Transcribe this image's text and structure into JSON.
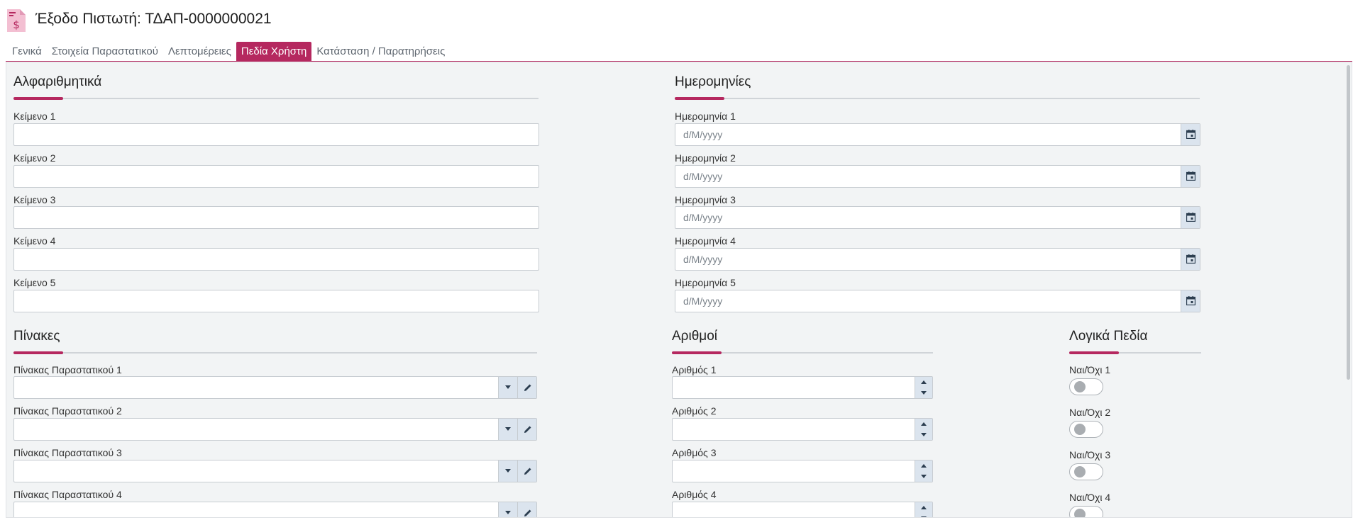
{
  "header": {
    "title": "Έξοδο Πιστωτή: ΤΔΑΠ-0000000021",
    "icon": "dollar-document-icon"
  },
  "tabs": [
    {
      "label": "Γενικά",
      "active": false
    },
    {
      "label": "Στοιχεία Παραστατικού",
      "active": false
    },
    {
      "label": "Λεπτομέρειες",
      "active": false
    },
    {
      "label": "Πεδία Χρήστη",
      "active": true
    },
    {
      "label": "Κατάσταση / Παρατηρήσεις",
      "active": false
    }
  ],
  "colors": {
    "accent": "#b5285f",
    "panel_bg": "#f2f4f5",
    "button_bg": "#dbe4ee"
  },
  "sections": {
    "alphanumeric": {
      "title": "Αλφαριθμητικά",
      "fields": [
        {
          "label": "Κείμενο 1",
          "value": ""
        },
        {
          "label": "Κείμενο 2",
          "value": ""
        },
        {
          "label": "Κείμενο 3",
          "value": ""
        },
        {
          "label": "Κείμενο 4",
          "value": ""
        },
        {
          "label": "Κείμενο 5",
          "value": ""
        }
      ]
    },
    "dates": {
      "title": "Ημερομηνίες",
      "fields": [
        {
          "label": "Ημερομηνία 1",
          "placeholder": "d/M/yyyy"
        },
        {
          "label": "Ημερομηνία 2",
          "placeholder": "d/M/yyyy"
        },
        {
          "label": "Ημερομηνία 3",
          "placeholder": "d/M/yyyy"
        },
        {
          "label": "Ημερομηνία 4",
          "placeholder": "d/M/yyyy"
        },
        {
          "label": "Ημερομηνία 5",
          "placeholder": "d/M/yyyy"
        }
      ]
    },
    "tables": {
      "title": "Πίνακες",
      "fields": [
        {
          "label": "Πίνακας Παραστατικού 1",
          "value": ""
        },
        {
          "label": "Πίνακας Παραστατικού 2",
          "value": ""
        },
        {
          "label": "Πίνακας Παραστατικού 3",
          "value": ""
        },
        {
          "label": "Πίνακας Παραστατικού 4",
          "value": ""
        }
      ]
    },
    "numbers": {
      "title": "Αριθμοί",
      "fields": [
        {
          "label": "Αριθμός 1",
          "value": ""
        },
        {
          "label": "Αριθμός 2",
          "value": ""
        },
        {
          "label": "Αριθμός 3",
          "value": ""
        },
        {
          "label": "Αριθμός 4",
          "value": ""
        }
      ]
    },
    "booleans": {
      "title": "Λογικά Πεδία",
      "fields": [
        {
          "label": "Ναι/Όχι 1",
          "checked": false
        },
        {
          "label": "Ναι/Όχι 2",
          "checked": false
        },
        {
          "label": "Ναι/Όχι 3",
          "checked": false
        },
        {
          "label": "Ναι/Όχι 4",
          "checked": false
        }
      ]
    }
  }
}
